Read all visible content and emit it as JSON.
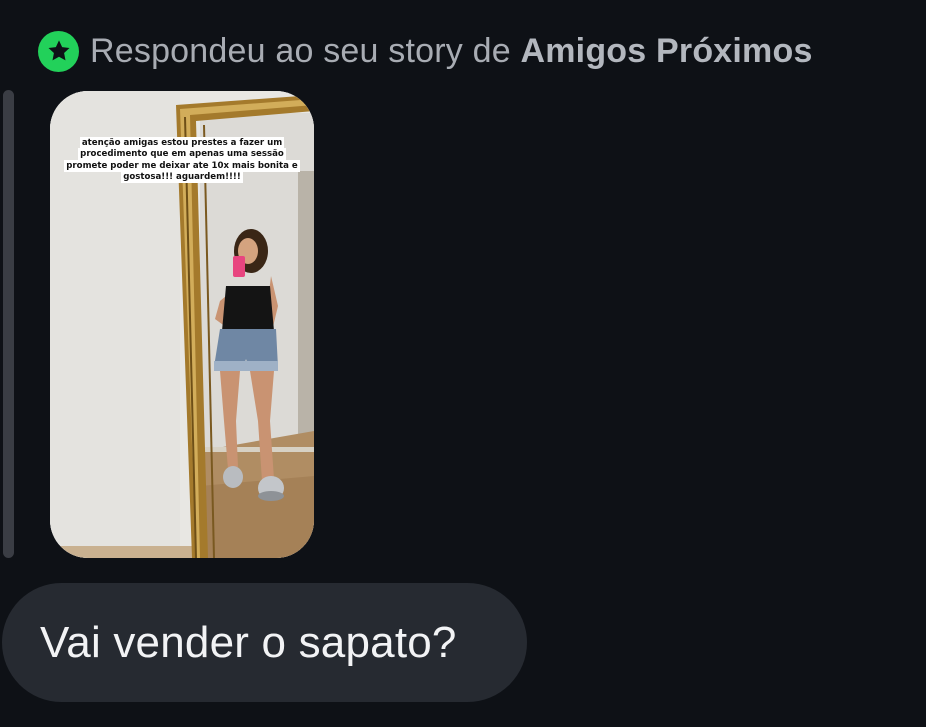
{
  "reply_header": {
    "prefix": "Respondeu ao seu story de ",
    "list_name": "Amigos Próximos",
    "badge_icon": "star-icon",
    "badge_color": "#22d15a"
  },
  "story": {
    "caption": "atenção amigas estou prestes a fazer um procedimento que em apenas uma sessão promete poder me deixar ate 10x mais bonita e gostosa!!! aguardem!!!!"
  },
  "message": {
    "text": "Vai vender o sapato?"
  }
}
